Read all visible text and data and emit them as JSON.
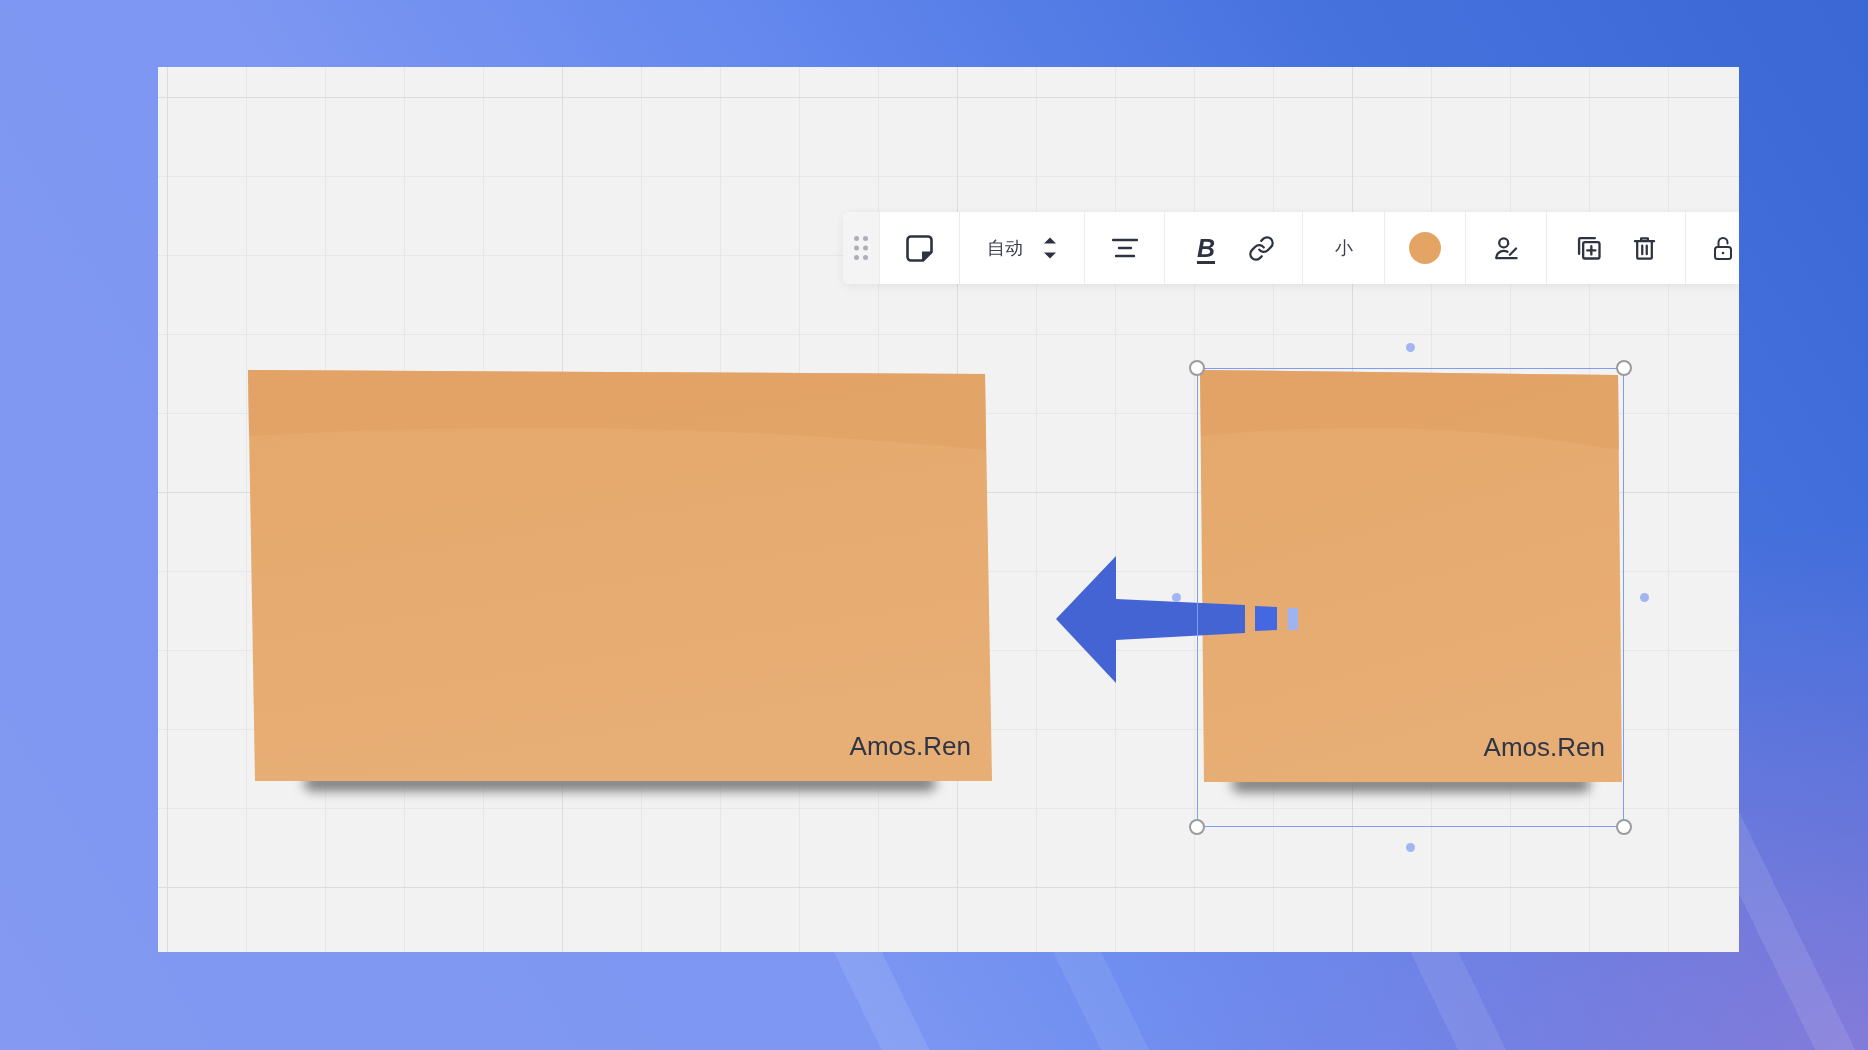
{
  "toolbar": {
    "size_mode": "自动",
    "bold_label": "B",
    "text_size": "小",
    "color": "#e4a564"
  },
  "sticky_notes": [
    {
      "author": "Amos.Ren",
      "selected": false
    },
    {
      "author": "Amos.Ren",
      "selected": true
    }
  ]
}
